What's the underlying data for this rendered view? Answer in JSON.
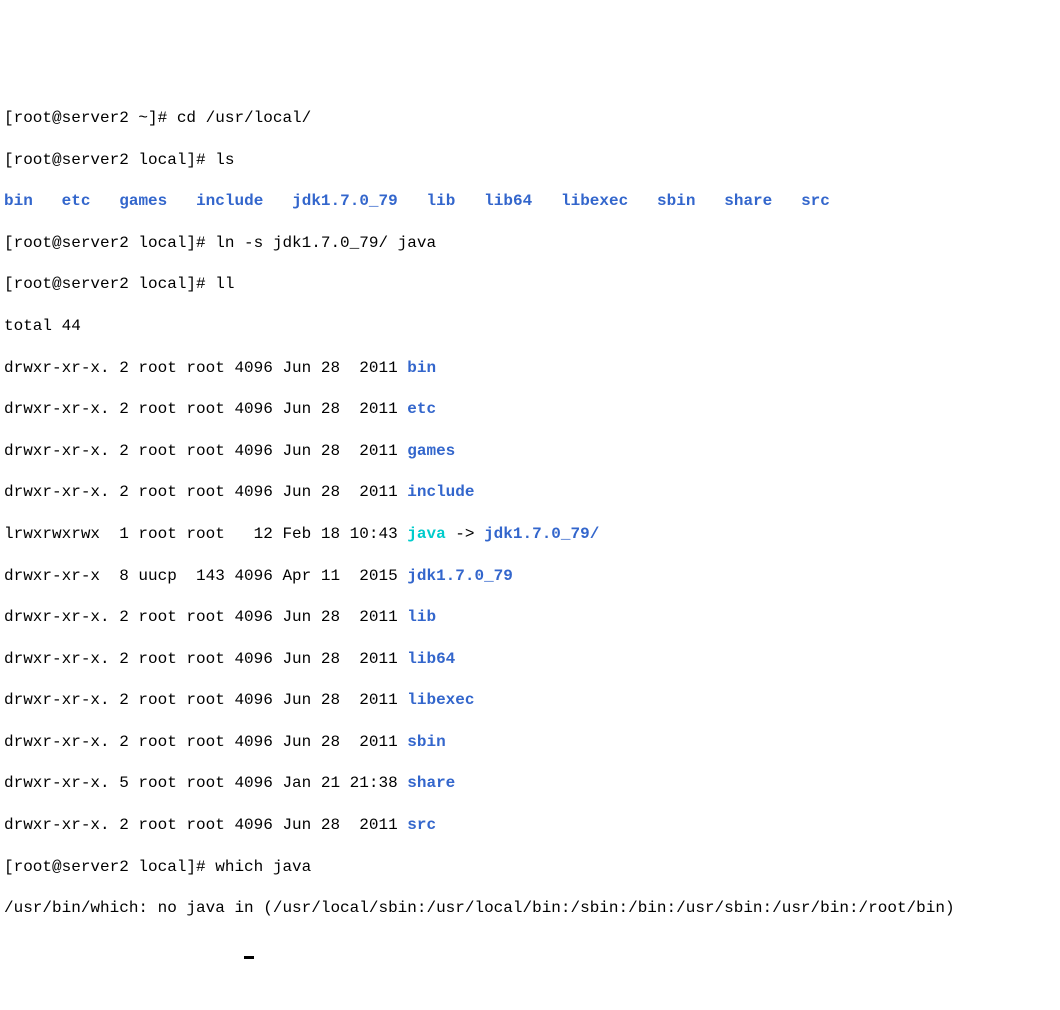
{
  "lines": {
    "l1": {
      "prompt": "[root@server2 ~]# ",
      "cmd": "cd /usr/local/"
    },
    "l2": {
      "prompt": "[root@server2 local]# ",
      "cmd": "ls"
    },
    "l3": {
      "d1": "bin",
      "s1": "   ",
      "d2": "etc",
      "s2": "   ",
      "d3": "games",
      "s3": "   ",
      "d4": "include",
      "s4": "   ",
      "d5": "jdk1.7.0_79",
      "s5": "   ",
      "d6": "lib",
      "s6": "   ",
      "d7": "lib64",
      "s7": "   ",
      "d8": "libexec",
      "s8": "   ",
      "d9": "sbin",
      "s9": "   ",
      "d10": "share",
      "s10": "   ",
      "d11": "src"
    },
    "l4": {
      "prompt": "[root@server2 local]# ",
      "cmd": "ln -s jdk1.7.0_79/ java"
    },
    "l5": {
      "prompt": "[root@server2 local]# ",
      "cmd": "ll"
    },
    "l6": {
      "text": "total 44"
    },
    "l7": {
      "perms": "drwxr-xr-x. 2 root root 4096 Jun 28  2011 ",
      "name": "bin"
    },
    "l8": {
      "perms": "drwxr-xr-x. 2 root root 4096 Jun 28  2011 ",
      "name": "etc"
    },
    "l9": {
      "perms": "drwxr-xr-x. 2 root root 4096 Jun 28  2011 ",
      "name": "games"
    },
    "l10": {
      "perms": "drwxr-xr-x. 2 root root 4096 Jun 28  2011 ",
      "name": "include"
    },
    "l11": {
      "perms": "lrwxrwxrwx  1 root root   12 Feb 18 10:43 ",
      "linkname": "java",
      "arrow": " -> ",
      "target": "jdk1.7.0_79/"
    },
    "l12": {
      "perms": "drwxr-xr-x  8 uucp  143 4096 Apr 11  2015 ",
      "name": "jdk1.7.0_79"
    },
    "l13": {
      "perms": "drwxr-xr-x. 2 root root 4096 Jun 28  2011 ",
      "name": "lib"
    },
    "l14": {
      "perms": "drwxr-xr-x. 2 root root 4096 Jun 28  2011 ",
      "name": "lib64"
    },
    "l15": {
      "perms": "drwxr-xr-x. 2 root root 4096 Jun 28  2011 ",
      "name": "libexec"
    },
    "l16": {
      "perms": "drwxr-xr-x. 2 root root 4096 Jun 28  2011 ",
      "name": "sbin"
    },
    "l17": {
      "perms": "drwxr-xr-x. 5 root root 4096 Jan 21 21:38 ",
      "name": "share"
    },
    "l18": {
      "perms": "drwxr-xr-x. 2 root root 4096 Jun 28  2011 ",
      "name": "src"
    },
    "l19": {
      "prompt": "[root@server2 local]# ",
      "cmd": "which java"
    },
    "l20": {
      "text": "/usr/bin/which: no java in (/usr/local/sbin:/usr/local/bin:/sbin:/bin:/usr/sbin:/usr/bin:/root/bin)"
    }
  }
}
